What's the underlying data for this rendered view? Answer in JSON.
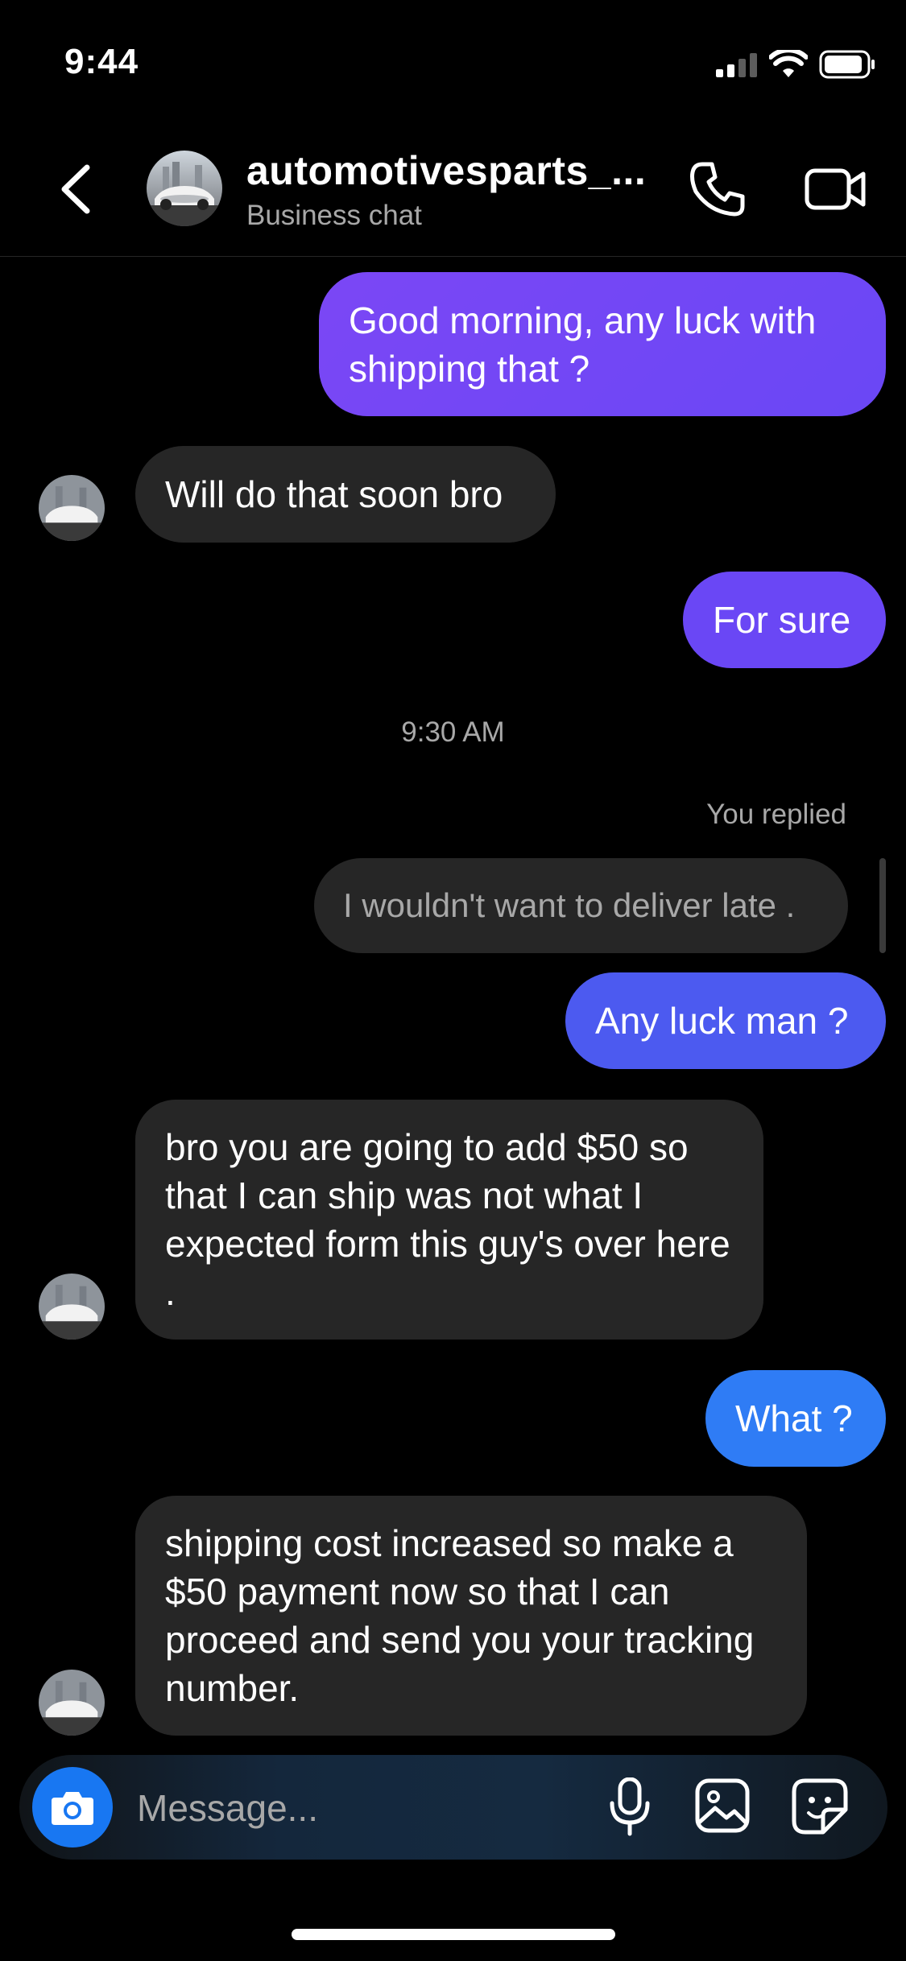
{
  "status": {
    "time": "9:44"
  },
  "header": {
    "title": "automotivesparts_...",
    "subtitle": "Business chat"
  },
  "messages": [
    {
      "from": "me",
      "text": "Good morning, any luck with shipping that ?"
    },
    {
      "from": "them",
      "text": "Will do that soon bro"
    },
    {
      "from": "me",
      "text": "For sure"
    },
    {
      "from": "me",
      "text": "Any luck man ?"
    },
    {
      "from": "them",
      "text": "bro you are going to add $50 so that I can ship was not what I expected form this guy's over here ."
    },
    {
      "from": "me",
      "text": "What ?"
    },
    {
      "from": "them",
      "text": "shipping cost increased so make a $50 payment now so that I can proceed and send you your tracking number."
    }
  ],
  "timestamp": "9:30 AM",
  "reply": {
    "label": "You replied",
    "quoted": "I wouldn't want to deliver late ."
  },
  "composer": {
    "placeholder": "Message..."
  },
  "colors": {
    "bubble_top": "#7b47f5",
    "bubble_mid": "#5a4af0",
    "bubble_bottom": "#2f7cf5",
    "received": "#262626",
    "camera": "#1877f2"
  },
  "icons": [
    "back-icon",
    "phone-icon",
    "video-camera-icon",
    "camera-icon",
    "microphone-icon",
    "gallery-icon",
    "sticker-icon"
  ]
}
